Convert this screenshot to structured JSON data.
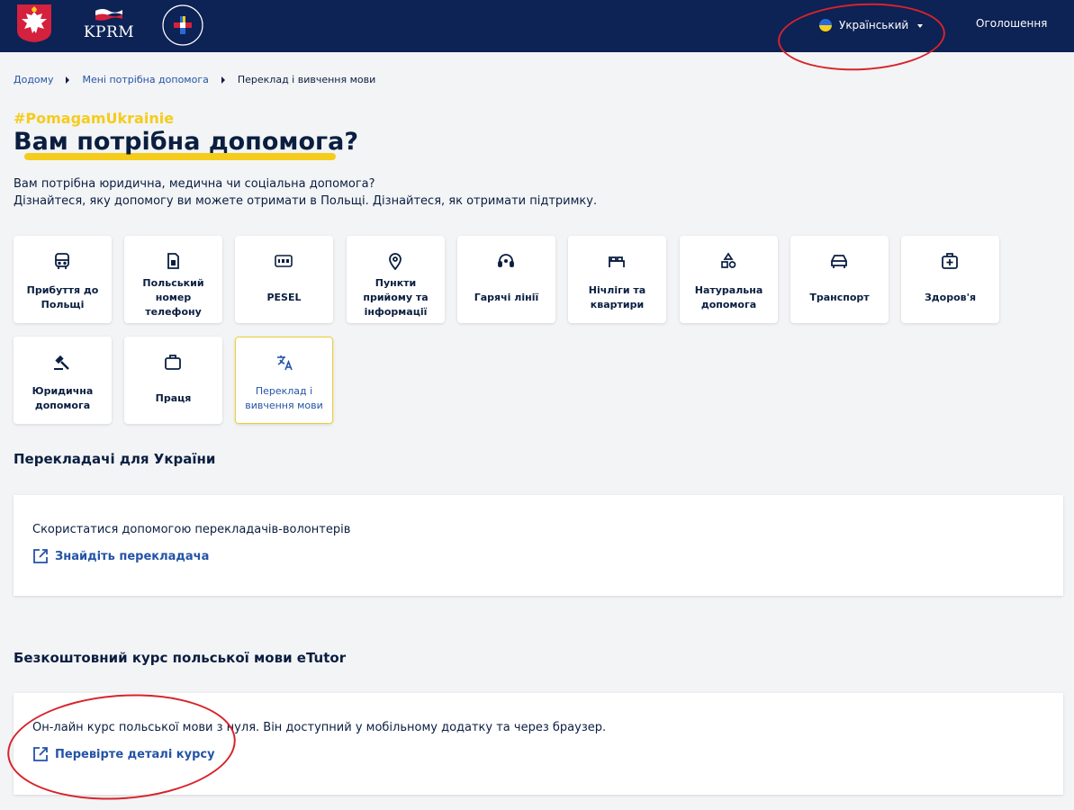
{
  "header": {
    "logo_text": "KPRM",
    "pomagam_logo_text": "#POMAGAM UKRAINIE",
    "language": "Український",
    "announcements": "Оголошення"
  },
  "breadcrumb": {
    "home": "Додому",
    "parent": "Мені потрібна допомога",
    "current": "Переклад і вивчення мови"
  },
  "hero": {
    "hashtag": "#PomagamUkrainie",
    "title": "Вам потрібна допомога?",
    "intro_line1": "Вам потрібна юридична, медична чи соціальна допомога?",
    "intro_line2": "Дізнайтеся, яку допомогу ви можете отримати в Польщі. Дізнайтеся, як отримати підтримку."
  },
  "tiles": [
    {
      "label": "Прибуття до Польщі",
      "icon": "bus-icon"
    },
    {
      "label": "Польський номер телефону",
      "icon": "sim-card-icon"
    },
    {
      "label": "PESEL",
      "icon": "pesel-123-icon"
    },
    {
      "label": "Пункти прийому та інформації",
      "icon": "location-pin-icon"
    },
    {
      "label": "Гарячі лінії",
      "icon": "headset-icon"
    },
    {
      "label": "Нічліги та квартири",
      "icon": "bed-icon"
    },
    {
      "label": "Натуральна допомога",
      "icon": "shapes-icon"
    },
    {
      "label": "Транспорт",
      "icon": "car-icon"
    },
    {
      "label": "Здоров'я",
      "icon": "medical-kit-icon"
    },
    {
      "label": "Юридична допомога",
      "icon": "gavel-icon"
    },
    {
      "label": "Праця",
      "icon": "briefcase-icon"
    },
    {
      "label": "Переклад і вивчення мови",
      "icon": "translate-icon",
      "active": true
    }
  ],
  "sections": {
    "translators": {
      "title": "Перекладачі для України",
      "text": "Скористатися допомогою перекладачів-волонтерів",
      "link": "Знайдіть перекладача"
    },
    "course": {
      "title": "Безкоштовний курс польської мови eTutor",
      "text": "Он-лайн курс польської мови з нуля. Він доступний у мобільному додатку та через браузер.",
      "link": "Перевірте деталі курсу"
    }
  },
  "colors": {
    "navy": "#0d2255",
    "accent_yellow": "#f5cc1b",
    "link_blue": "#2453a6",
    "annotation_red": "#d8232a"
  }
}
